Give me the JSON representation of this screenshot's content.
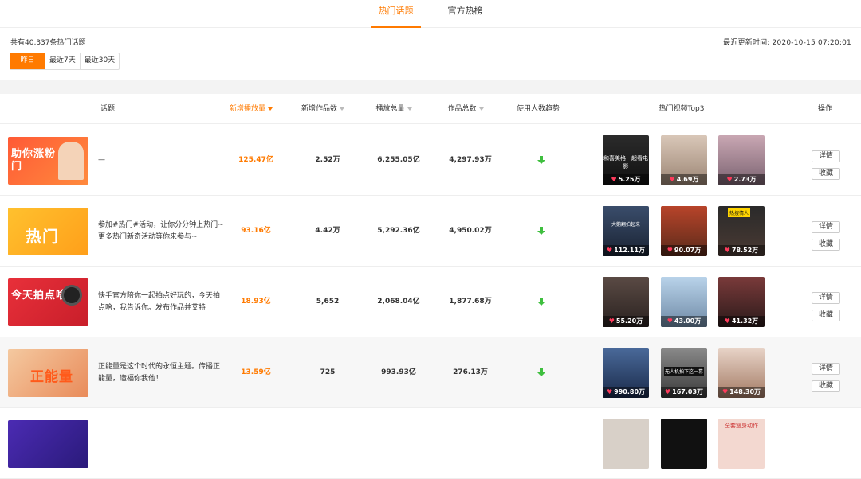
{
  "tabs": [
    "热门话题",
    "官方热榜"
  ],
  "summary": {
    "total": "共有40,337条热门话题",
    "updated": "最近更新时间: 2020-10-15 07:20:01"
  },
  "range": [
    "昨日",
    "最近7天",
    "最近30天"
  ],
  "columns": {
    "topic": "话题",
    "new_plays": "新增播放量",
    "new_works": "新增作品数",
    "total_plays": "播放总量",
    "total_works": "作品总数",
    "trend": "使用人数趋势",
    "top3": "热门视频Top3",
    "action": "操作"
  },
  "actions": {
    "detail": "详情",
    "fav": "收藏"
  },
  "rows": [
    {
      "thumb_text": "助你涨粉 上热门",
      "desc": "—",
      "new_plays": "125.47亿",
      "new_works": "2.52万",
      "total_plays": "6,255.05亿",
      "total_works": "4,297.93万",
      "trend": "down",
      "videos": [
        {
          "caption": "和喜美格一起看电影",
          "likes": "5.25万"
        },
        {
          "caption": "",
          "likes": "4.69万"
        },
        {
          "caption": "",
          "likes": "2.73万"
        }
      ]
    },
    {
      "thumb_text": "热门",
      "desc": "参加#热门#活动，让你分分钟上热门~更多热门新奇活动等你来参与~",
      "new_plays": "93.16亿",
      "new_works": "4.42万",
      "total_plays": "5,292.36亿",
      "total_works": "4,950.02万",
      "trend": "down",
      "videos": [
        {
          "caption": "大鹅翻拍起来",
          "likes": "112.11万"
        },
        {
          "caption": "",
          "likes": "90.07万"
        },
        {
          "caption": "热搜情人",
          "likes": "78.52万"
        }
      ]
    },
    {
      "thumb_text": "今天拍点啥?",
      "desc": "快手官方陪你一起拍点好玩的，今天拍点啥，我告诉你。发布作品并艾特",
      "new_plays": "18.93亿",
      "new_works": "5,652",
      "total_plays": "2,068.04亿",
      "total_works": "1,877.68万",
      "trend": "down",
      "videos": [
        {
          "caption": "",
          "likes": "55.20万"
        },
        {
          "caption": "",
          "likes": "43.00万"
        },
        {
          "caption": "",
          "likes": "41.32万"
        }
      ]
    },
    {
      "thumb_text": "正能量",
      "desc": "正能量是这个时代的永恒主题。传播正能量，造福你我他！",
      "new_plays": "13.59亿",
      "new_works": "725",
      "total_plays": "993.93亿",
      "total_works": "276.13万",
      "trend": "down",
      "videos": [
        {
          "caption": "",
          "likes": "990.80万"
        },
        {
          "caption": "无人机拍下这一幕",
          "likes": "167.03万"
        },
        {
          "caption": "",
          "likes": "148.30万"
        }
      ]
    },
    {
      "thumb_text": "",
      "desc": "",
      "new_plays": "",
      "new_works": "",
      "total_plays": "",
      "total_works": "",
      "trend": "",
      "videos": [
        {
          "caption": "",
          "likes": ""
        },
        {
          "caption": "",
          "likes": ""
        },
        {
          "caption": "全套瘦身动作",
          "likes": ""
        }
      ]
    }
  ],
  "colors": {
    "accent": "#ff7a00",
    "trend_down": "#3fbf3f",
    "heart": "#ff3b5c"
  }
}
